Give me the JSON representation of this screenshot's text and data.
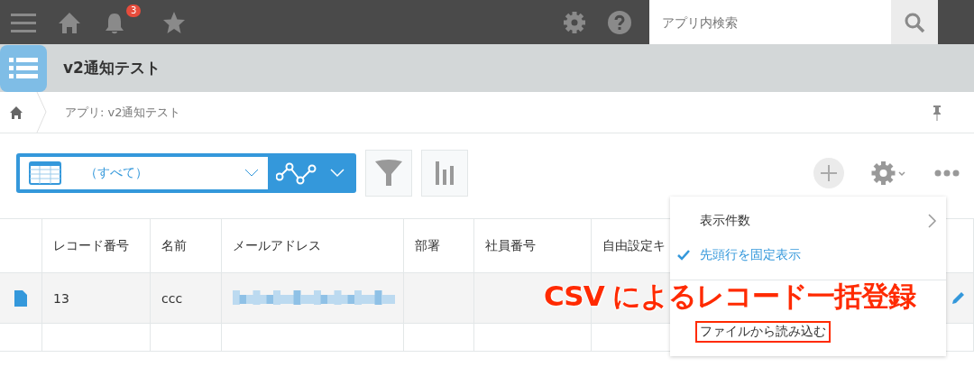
{
  "top_bar": {
    "notification_count": "3",
    "search": {
      "placeholder": "アプリ内検索"
    }
  },
  "app_header": {
    "title": "v2通知テスト"
  },
  "breadcrumb": {
    "items": [
      "アプリ: v2通知テスト"
    ]
  },
  "view_selector": {
    "label": "（すべて）"
  },
  "table": {
    "columns": [
      "レコード番号",
      "名前",
      "メールアドレス",
      "部署",
      "社員番号",
      "自由設定キ"
    ],
    "rows": [
      {
        "cells": [
          "13",
          "ccc"
        ]
      }
    ]
  },
  "menu": {
    "items": [
      {
        "kind": "submenu",
        "label": "表示件数",
        "checked": false,
        "highlighted": false
      },
      {
        "kind": "toggle",
        "label": "先頭行を固定表示",
        "checked": true,
        "highlighted": false
      },
      {
        "kind": "divider"
      },
      {
        "kind": "hidden"
      },
      {
        "kind": "action",
        "label": "ファイルから読み込む",
        "checked": false,
        "highlighted": true
      }
    ]
  },
  "annotation": {
    "text": "CSV によるレコード一括登録"
  }
}
